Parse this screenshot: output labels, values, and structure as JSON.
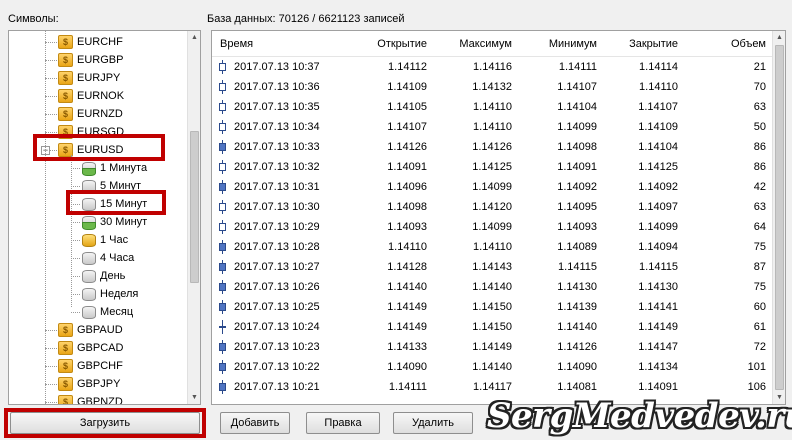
{
  "labels": {
    "symbols": "Символы:",
    "database": "База данных: 70126 / 6621123 записей"
  },
  "tree": {
    "items": [
      {
        "label": "EURCHF",
        "icon": "symbol-icon",
        "level": 0
      },
      {
        "label": "EURGBP",
        "icon": "symbol-icon",
        "level": 0
      },
      {
        "label": "EURJPY",
        "icon": "symbol-icon",
        "level": 0
      },
      {
        "label": "EURNOK",
        "icon": "symbol-icon",
        "level": 0
      },
      {
        "label": "EURNZD",
        "icon": "symbol-icon",
        "level": 0
      },
      {
        "label": "EURSGD",
        "icon": "symbol-icon",
        "level": 0
      },
      {
        "label": "EURUSD",
        "icon": "symbol-icon",
        "level": 0,
        "expanded": true
      },
      {
        "label": "1 Минута",
        "icon": "database-icon",
        "level": 1,
        "state": "half"
      },
      {
        "label": "5 Минут",
        "icon": "database-icon",
        "level": 1,
        "state": "empty"
      },
      {
        "label": "15 Минут",
        "icon": "database-icon",
        "level": 1,
        "state": "empty"
      },
      {
        "label": "30 Минут",
        "icon": "database-icon",
        "level": 1,
        "state": "half"
      },
      {
        "label": "1 Час",
        "icon": "database-icon",
        "level": 1,
        "state": "filled"
      },
      {
        "label": "4 Часа",
        "icon": "database-icon",
        "level": 1,
        "state": "empty"
      },
      {
        "label": "День",
        "icon": "database-icon",
        "level": 1,
        "state": "empty"
      },
      {
        "label": "Неделя",
        "icon": "database-icon",
        "level": 1,
        "state": "empty"
      },
      {
        "label": "Месяц",
        "icon": "database-icon",
        "level": 1,
        "state": "empty"
      },
      {
        "label": "GBPAUD",
        "icon": "symbol-icon",
        "level": 0
      },
      {
        "label": "GBPCAD",
        "icon": "symbol-icon",
        "level": 0
      },
      {
        "label": "GBPCHF",
        "icon": "symbol-icon",
        "level": 0
      },
      {
        "label": "GBPJPY",
        "icon": "symbol-icon",
        "level": 0
      },
      {
        "label": "GBPNZD",
        "icon": "symbol-icon",
        "level": 0
      }
    ]
  },
  "table": {
    "columns": [
      "Время",
      "Открытие",
      "Максимум",
      "Минимум",
      "Закрытие",
      "Объем"
    ],
    "rows": [
      {
        "candle": "bear",
        "time": "2017.07.13 10:37",
        "open": "1.14112",
        "high": "1.14116",
        "low": "1.14111",
        "close": "1.14114",
        "volume": "21"
      },
      {
        "candle": "bear",
        "time": "2017.07.13 10:36",
        "open": "1.14109",
        "high": "1.14132",
        "low": "1.14107",
        "close": "1.14110",
        "volume": "70"
      },
      {
        "candle": "bear",
        "time": "2017.07.13 10:35",
        "open": "1.14105",
        "high": "1.14110",
        "low": "1.14104",
        "close": "1.14107",
        "volume": "63"
      },
      {
        "candle": "bear",
        "time": "2017.07.13 10:34",
        "open": "1.14107",
        "high": "1.14110",
        "low": "1.14099",
        "close": "1.14109",
        "volume": "50"
      },
      {
        "candle": "bull",
        "time": "2017.07.13 10:33",
        "open": "1.14126",
        "high": "1.14126",
        "low": "1.14098",
        "close": "1.14104",
        "volume": "86"
      },
      {
        "candle": "bear",
        "time": "2017.07.13 10:32",
        "open": "1.14091",
        "high": "1.14125",
        "low": "1.14091",
        "close": "1.14125",
        "volume": "86"
      },
      {
        "candle": "bull",
        "time": "2017.07.13 10:31",
        "open": "1.14096",
        "high": "1.14099",
        "low": "1.14092",
        "close": "1.14092",
        "volume": "42"
      },
      {
        "candle": "bear",
        "time": "2017.07.13 10:30",
        "open": "1.14098",
        "high": "1.14120",
        "low": "1.14095",
        "close": "1.14097",
        "volume": "63"
      },
      {
        "candle": "bear",
        "time": "2017.07.13 10:29",
        "open": "1.14093",
        "high": "1.14099",
        "low": "1.14093",
        "close": "1.14099",
        "volume": "64"
      },
      {
        "candle": "bull",
        "time": "2017.07.13 10:28",
        "open": "1.14110",
        "high": "1.14110",
        "low": "1.14089",
        "close": "1.14094",
        "volume": "75"
      },
      {
        "candle": "bull",
        "time": "2017.07.13 10:27",
        "open": "1.14128",
        "high": "1.14143",
        "low": "1.14115",
        "close": "1.14115",
        "volume": "87"
      },
      {
        "candle": "bull",
        "time": "2017.07.13 10:26",
        "open": "1.14140",
        "high": "1.14140",
        "low": "1.14130",
        "close": "1.14130",
        "volume": "75"
      },
      {
        "candle": "bull",
        "time": "2017.07.13 10:25",
        "open": "1.14149",
        "high": "1.14150",
        "low": "1.14139",
        "close": "1.14141",
        "volume": "60"
      },
      {
        "candle": "doji",
        "time": "2017.07.13 10:24",
        "open": "1.14149",
        "high": "1.14150",
        "low": "1.14140",
        "close": "1.14149",
        "volume": "61"
      },
      {
        "candle": "bull",
        "time": "2017.07.13 10:23",
        "open": "1.14133",
        "high": "1.14149",
        "low": "1.14126",
        "close": "1.14147",
        "volume": "72"
      },
      {
        "candle": "bull",
        "time": "2017.07.13 10:22",
        "open": "1.14090",
        "high": "1.14140",
        "low": "1.14090",
        "close": "1.14134",
        "volume": "101"
      },
      {
        "candle": "bull",
        "time": "2017.07.13 10:21",
        "open": "1.14111",
        "high": "1.14117",
        "low": "1.14081",
        "close": "1.14091",
        "volume": "106"
      }
    ]
  },
  "buttons": {
    "load": "Загрузить",
    "add": "Добавить",
    "edit": "Правка",
    "delete": "Удалить"
  },
  "watermark": "SergMedvedev.ru",
  "colors": {
    "highlight": "#c00000",
    "candle_bull": "#4f74c2",
    "candle_outline": "#2b4a8c"
  }
}
